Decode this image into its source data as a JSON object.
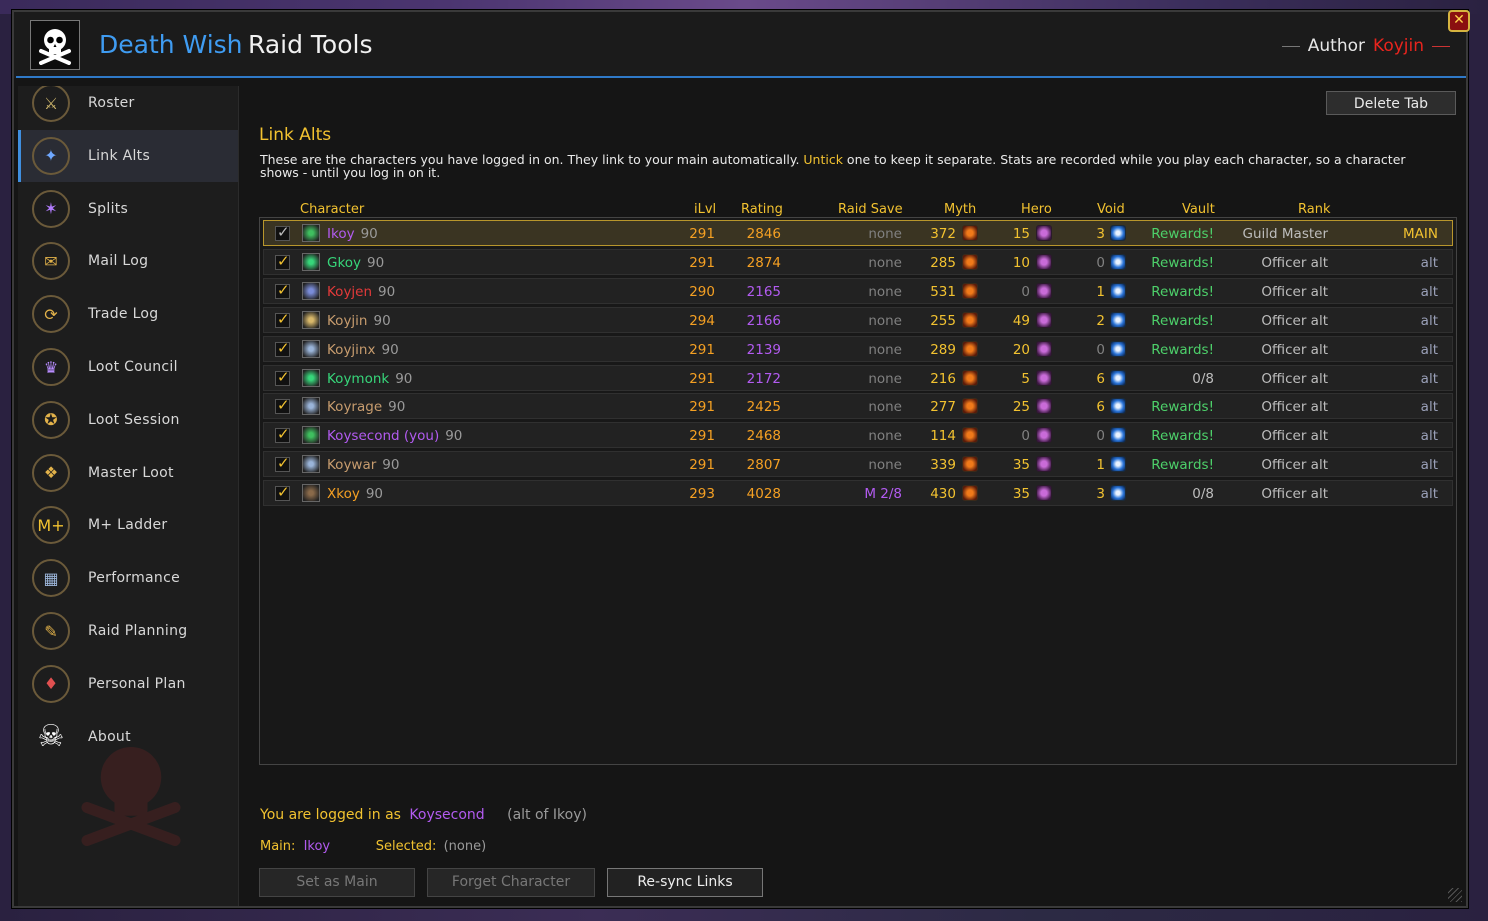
{
  "header": {
    "title_primary": "Death Wish",
    "title_secondary": "Raid Tools",
    "author_label": "Author",
    "author_name": "Koyjin",
    "close_label": "✕"
  },
  "sidebar": {
    "items": [
      {
        "label": "Roster",
        "icon": "roster-icon",
        "glyph": "⚔",
        "color": "#c9b26a"
      },
      {
        "label": "Link Alts",
        "icon": "link-icon",
        "glyph": "✦",
        "color": "#6fa8ff"
      },
      {
        "label": "Splits",
        "icon": "splits-icon",
        "glyph": "✶",
        "color": "#b27cff"
      },
      {
        "label": "Mail Log",
        "icon": "mail-icon",
        "glyph": "✉",
        "color": "#e2b24a"
      },
      {
        "label": "Trade Log",
        "icon": "trade-icon",
        "glyph": "⟳",
        "color": "#e2b24a"
      },
      {
        "label": "Loot Council",
        "icon": "loot-council-icon",
        "glyph": "♛",
        "color": "#b88cff"
      },
      {
        "label": "Loot Session",
        "icon": "loot-session-icon",
        "glyph": "✪",
        "color": "#e2b24a"
      },
      {
        "label": "Master Loot",
        "icon": "master-loot-icon",
        "glyph": "❖",
        "color": "#e2b24a"
      },
      {
        "label": "M+ Ladder",
        "icon": "mplus-icon",
        "glyph": "M+",
        "color": "#f2c230"
      },
      {
        "label": "Performance",
        "icon": "performance-icon",
        "glyph": "▦",
        "color": "#9ab4d8"
      },
      {
        "label": "Raid Planning",
        "icon": "raid-planning-icon",
        "glyph": "✎",
        "color": "#e2b24a"
      },
      {
        "label": "Personal Plan",
        "icon": "personal-plan-icon",
        "glyph": "♦",
        "color": "#e05050"
      },
      {
        "label": "About",
        "icon": "skull-icon",
        "glyph": "☠",
        "color": "#ffffff"
      }
    ],
    "active_index": 1
  },
  "main": {
    "delete_tab_label": "Delete Tab",
    "section_title": "Link Alts",
    "description_part1": "These are the characters you have logged in on. They link to your main automatically. ",
    "description_highlight": "Untick",
    "description_part2": " one to keep it separate. Stats are recorded while you play each character, so a character shows - until you log in on it.",
    "columns": {
      "character": "Character",
      "ilvl": "iLvl",
      "rating": "Rating",
      "raid_save": "Raid Save",
      "myth": "Myth",
      "hero": "Hero",
      "void": "Void",
      "vault": "Vault",
      "rank": "Rank"
    },
    "rows": [
      {
        "name": "Ikoy",
        "name_color": "#b25bf0",
        "level": "90",
        "ilvl": "291",
        "rating": "2846",
        "rating_color": "#f5a023",
        "raid_save": "none",
        "raid_save_color": "#808080",
        "myth": "372",
        "hero": "15",
        "hero_color": "#f2c230",
        "void": "3",
        "void_color": "#f2c230",
        "vault": "Rewards!",
        "vault_color": "#4dd06a",
        "rank": "Guild Master",
        "role": "MAIN",
        "class_color": "#3fbf5f",
        "checked": true,
        "is_main": true
      },
      {
        "name": "Gkoy",
        "name_color": "#37d67a",
        "level": "90",
        "ilvl": "291",
        "rating": "2874",
        "rating_color": "#f5a023",
        "raid_save": "none",
        "raid_save_color": "#808080",
        "myth": "285",
        "hero": "10",
        "hero_color": "#f2c230",
        "void": "0",
        "void_color": "#808080",
        "vault": "Rewards!",
        "vault_color": "#4dd06a",
        "rank": "Officer alt",
        "role": "alt",
        "class_color": "#37d67a",
        "checked": true,
        "is_main": false
      },
      {
        "name": "Koyjen",
        "name_color": "#e33a3a",
        "level": "90",
        "ilvl": "290",
        "rating": "2165",
        "rating_color": "#b25bf0",
        "raid_save": "none",
        "raid_save_color": "#808080",
        "myth": "531",
        "hero": "0",
        "hero_color": "#808080",
        "void": "1",
        "void_color": "#f2c230",
        "vault": "Rewards!",
        "vault_color": "#4dd06a",
        "rank": "Officer alt",
        "role": "alt",
        "class_color": "#7a8cd8",
        "checked": true,
        "is_main": false
      },
      {
        "name": "Koyjin",
        "name_color": "#c79c6e",
        "level": "90",
        "ilvl": "294",
        "rating": "2166",
        "rating_color": "#b25bf0",
        "raid_save": "none",
        "raid_save_color": "#808080",
        "myth": "255",
        "hero": "49",
        "hero_color": "#f2c230",
        "void": "2",
        "void_color": "#f2c230",
        "vault": "Rewards!",
        "vault_color": "#4dd06a",
        "rank": "Officer alt",
        "role": "alt",
        "class_color": "#d8b86a",
        "checked": true,
        "is_main": false
      },
      {
        "name": "Koyjinx",
        "name_color": "#c79c6e",
        "level": "90",
        "ilvl": "291",
        "rating": "2139",
        "rating_color": "#b25bf0",
        "raid_save": "none",
        "raid_save_color": "#808080",
        "myth": "289",
        "hero": "20",
        "hero_color": "#f2c230",
        "void": "0",
        "void_color": "#808080",
        "vault": "Rewards!",
        "vault_color": "#4dd06a",
        "rank": "Officer alt",
        "role": "alt",
        "class_color": "#9ab4d8",
        "checked": true,
        "is_main": false
      },
      {
        "name": "Koymonk",
        "name_color": "#37d67a",
        "level": "90",
        "ilvl": "291",
        "rating": "2172",
        "rating_color": "#b25bf0",
        "raid_save": "none",
        "raid_save_color": "#808080",
        "myth": "216",
        "hero": "5",
        "hero_color": "#f2c230",
        "void": "6",
        "void_color": "#f2c230",
        "vault": "0/8",
        "vault_color": "#bdbdbd",
        "rank": "Officer alt",
        "role": "alt",
        "class_color": "#37d67a",
        "checked": true,
        "is_main": false
      },
      {
        "name": "Koyrage",
        "name_color": "#c79c6e",
        "level": "90",
        "ilvl": "291",
        "rating": "2425",
        "rating_color": "#f5a023",
        "raid_save": "none",
        "raid_save_color": "#808080",
        "myth": "277",
        "hero": "25",
        "hero_color": "#f2c230",
        "void": "6",
        "void_color": "#f2c230",
        "vault": "Rewards!",
        "vault_color": "#4dd06a",
        "rank": "Officer alt",
        "role": "alt",
        "class_color": "#9ab4d8",
        "checked": true,
        "is_main": false
      },
      {
        "name": "Koysecond (you)",
        "name_color": "#b25bf0",
        "level": "90",
        "ilvl": "291",
        "rating": "2468",
        "rating_color": "#f5a023",
        "raid_save": "none",
        "raid_save_color": "#808080",
        "myth": "114",
        "hero": "0",
        "hero_color": "#808080",
        "void": "0",
        "void_color": "#808080",
        "vault": "Rewards!",
        "vault_color": "#4dd06a",
        "rank": "Officer alt",
        "role": "alt",
        "class_color": "#3fbf5f",
        "checked": true,
        "is_main": false
      },
      {
        "name": "Koywar",
        "name_color": "#c79c6e",
        "level": "90",
        "ilvl": "291",
        "rating": "2807",
        "rating_color": "#f5a023",
        "raid_save": "none",
        "raid_save_color": "#808080",
        "myth": "339",
        "hero": "35",
        "hero_color": "#f2c230",
        "void": "1",
        "void_color": "#f2c230",
        "vault": "Rewards!",
        "vault_color": "#4dd06a",
        "rank": "Officer alt",
        "role": "alt",
        "class_color": "#9ab4d8",
        "checked": true,
        "is_main": false
      },
      {
        "name": "Xkoy",
        "name_color": "#f5a023",
        "level": "90",
        "ilvl": "293",
        "rating": "4028",
        "rating_color": "#f5a023",
        "raid_save": "M 2/8",
        "raid_save_color": "#b25bf0",
        "myth": "430",
        "hero": "35",
        "hero_color": "#f2c230",
        "void": "3",
        "void_color": "#f2c230",
        "vault": "0/8",
        "vault_color": "#bdbdbd",
        "rank": "Officer alt",
        "role": "alt",
        "class_color": "#8a6a4a",
        "checked": true,
        "is_main": false
      }
    ]
  },
  "footer": {
    "logged_in_prefix": "You are logged in as",
    "logged_in_name": "Koysecond",
    "alt_of": "(alt of Ikoy)",
    "main_label": "Main:",
    "main_value": "Ikoy",
    "selected_label": "Selected:",
    "selected_value": "(none)",
    "buttons": {
      "set_main": "Set as Main",
      "forget": "Forget Character",
      "resync": "Re-sync Links"
    }
  },
  "colors": {
    "accent_blue": "#3f9cf2",
    "gold": "#f2c230",
    "author_red": "#e8241d"
  }
}
